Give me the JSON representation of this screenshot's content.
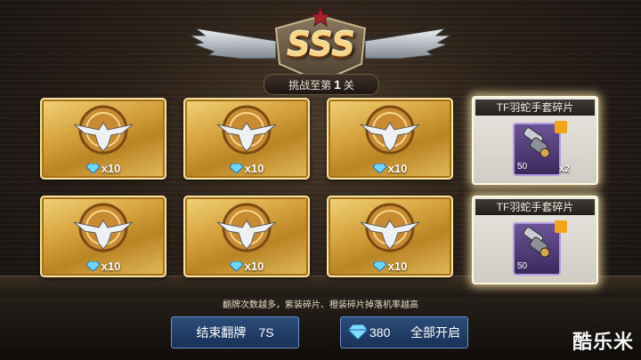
{
  "header": {
    "rank": "SSS",
    "subtitle_prefix": "挑战至第",
    "subtitle_number": "1",
    "subtitle_suffix": "关"
  },
  "cards": [
    {
      "reward_icon": "diamond-icon",
      "reward_text": "x10"
    },
    {
      "reward_icon": "diamond-icon",
      "reward_text": "x10"
    },
    {
      "reward_icon": "diamond-icon",
      "reward_text": "x10"
    },
    {
      "reward_icon": "diamond-icon",
      "reward_text": "x10"
    },
    {
      "reward_icon": "diamond-icon",
      "reward_text": "x10"
    },
    {
      "reward_icon": "diamond-icon",
      "reward_text": "x10"
    }
  ],
  "revealed": [
    {
      "title": "TF羽蛇手套碎片",
      "level": "50",
      "quantity": "x2",
      "icon": "gauntlet-icon"
    },
    {
      "title": "TF羽蛇手套碎片",
      "level": "50",
      "quantity": "",
      "icon": "gauntlet-icon"
    }
  ],
  "hint": "翻牌次数越多，紫装碎片、橙装碎片掉落机率越高",
  "buttons": {
    "end_label": "结束翻牌",
    "end_timer": "7S",
    "open_all_cost": "380",
    "open_all_label": "全部开启"
  },
  "watermark": "酷乐米",
  "colors": {
    "gold": "#d5a33e",
    "button_blue": "#183057",
    "purple_rarity": "#6b5398"
  }
}
